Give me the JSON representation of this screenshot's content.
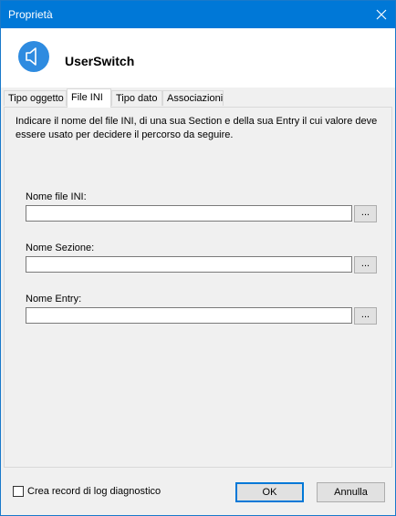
{
  "window": {
    "title": "Proprietà",
    "accent": "#0078d7"
  },
  "header": {
    "app_name": "UserSwitch",
    "icon": "speaker-icon"
  },
  "tabs": [
    {
      "label": "Tipo oggetto",
      "active": false
    },
    {
      "label": "File INI",
      "active": true
    },
    {
      "label": "Tipo dato",
      "active": false
    },
    {
      "label": "Associazioni",
      "active": false
    }
  ],
  "panel": {
    "description": "Indicare il nome del file INI, di una sua Section e della sua Entry il cui valore deve essere usato per decidere il percorso da seguire.",
    "fields": [
      {
        "label": "Nome file INI:",
        "value": "",
        "browse_label": "..."
      },
      {
        "label": "Nome Sezione:",
        "value": "",
        "browse_label": "..."
      },
      {
        "label": "Nome Entry:",
        "value": "",
        "browse_label": "..."
      }
    ]
  },
  "footer": {
    "checkbox_label": "Crea record di log diagnostico",
    "checkbox_checked": false,
    "ok_label": "OK",
    "cancel_label": "Annulla"
  }
}
